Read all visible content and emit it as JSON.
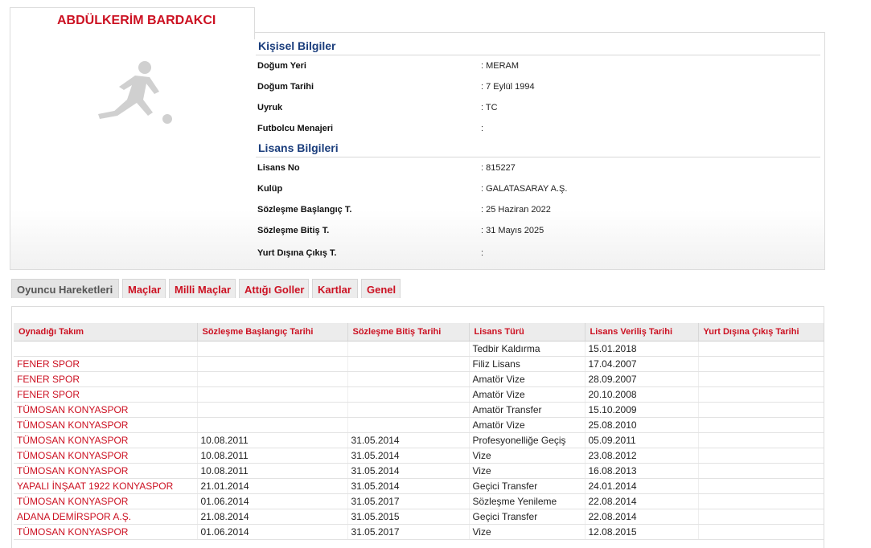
{
  "player": {
    "name": "ABDÜLKERİM BARDAKCI"
  },
  "personal": {
    "title": "Kişisel Bilgiler",
    "rows": [
      {
        "label": "Doğum Yeri",
        "value": ":  MERAM"
      },
      {
        "label": "Doğum Tarihi",
        "value": ":  7 Eylül 1994"
      },
      {
        "label": "Uyruk",
        "value": ":  TC"
      },
      {
        "label": "Futbolcu Menajeri",
        "value": ":"
      }
    ]
  },
  "license": {
    "title": "Lisans Bilgileri",
    "rows": [
      {
        "label": "Lisans No",
        "value": ": 815227"
      },
      {
        "label": "Kulüp",
        "value": ": GALATASARAY A.Ş."
      },
      {
        "label": "Sözleşme Başlangıç T.",
        "value": ": 25 Haziran 2022"
      },
      {
        "label": "Sözleşme Bitiş T.",
        "value": ": 31 Mayıs 2025"
      },
      {
        "label": "Yurt Dışına Çıkış T.",
        "value": ":"
      }
    ]
  },
  "tabs": [
    "Oyuncu Hareketleri",
    "Maçlar",
    "Milli Maçlar",
    "Attığı Goller",
    "Kartlar",
    "Genel"
  ],
  "table": {
    "headers": [
      "Oynadığı Takım",
      "Sözleşme Başlangıç Tarihi",
      "Sözleşme Bitiş Tarihi",
      "Lisans Türü",
      "Lisans Veriliş Tarihi",
      "Yurt Dışına Çıkış Tarihi"
    ],
    "rows": [
      [
        "",
        "",
        "",
        "Tedbir Kaldırma",
        "15.01.2018",
        ""
      ],
      [
        "FENER SPOR",
        "",
        "",
        "Filiz Lisans",
        "17.04.2007",
        ""
      ],
      [
        "FENER SPOR",
        "",
        "",
        "Amatör Vize",
        "28.09.2007",
        ""
      ],
      [
        "FENER SPOR",
        "",
        "",
        "Amatör Vize",
        "20.10.2008",
        ""
      ],
      [
        "TÜMOSAN KONYASPOR",
        "",
        "",
        "Amatör Transfer",
        "15.10.2009",
        ""
      ],
      [
        "TÜMOSAN KONYASPOR",
        "",
        "",
        "Amatör Vize",
        "25.08.2010",
        ""
      ],
      [
        "TÜMOSAN KONYASPOR",
        "10.08.2011",
        "31.05.2014",
        "Profesyonelliğe Geçiş",
        "05.09.2011",
        ""
      ],
      [
        "TÜMOSAN KONYASPOR",
        "10.08.2011",
        "31.05.2014",
        "Vize",
        "23.08.2012",
        ""
      ],
      [
        "TÜMOSAN KONYASPOR",
        "10.08.2011",
        "31.05.2014",
        "Vize",
        "16.08.2013",
        ""
      ],
      [
        "YAPALI İNŞAAT 1922 KONYASPOR",
        "21.01.2014",
        "31.05.2014",
        "Geçici Transfer",
        "24.01.2014",
        ""
      ],
      [
        "TÜMOSAN KONYASPOR",
        "01.06.2014",
        "31.05.2017",
        "Sözleşme Yenileme",
        "22.08.2014",
        ""
      ],
      [
        "ADANA DEMİRSPOR A.Ş.",
        "21.08.2014",
        "31.05.2015",
        "Geçici Transfer",
        "22.08.2014",
        ""
      ],
      [
        "TÜMOSAN KONYASPOR",
        "01.06.2014",
        "31.05.2017",
        "Vize",
        "12.08.2015",
        ""
      ]
    ]
  },
  "colors": {
    "accent": "#cc1122",
    "section_title": "#1a3d7c"
  }
}
